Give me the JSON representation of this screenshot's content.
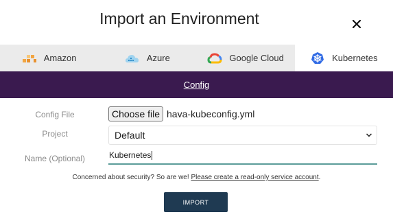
{
  "dialog": {
    "title": "Import an Environment",
    "close_icon": "close-icon"
  },
  "tabs": [
    {
      "label": "Amazon",
      "icon": "aws-icon",
      "active": false
    },
    {
      "label": "Azure",
      "icon": "azure-icon",
      "active": false
    },
    {
      "label": "Google Cloud",
      "icon": "google-cloud-icon",
      "active": false
    },
    {
      "label": "Kubernetes",
      "icon": "kubernetes-icon",
      "active": true
    }
  ],
  "config_tab": {
    "label": "Config"
  },
  "form": {
    "config_file": {
      "label": "Config File",
      "button": "Choose file",
      "file_name": "hava-kubeconfig.yml"
    },
    "project": {
      "label": "Project",
      "value": "Default"
    },
    "name": {
      "label": "Name (Optional)",
      "value": "Kubernetes"
    }
  },
  "security": {
    "text": "Concerned about security? So are we! ",
    "link": "Please create a read-only service account",
    "suffix": "."
  },
  "import_button": "IMPORT",
  "colors": {
    "config_bar": "#3a1a4f",
    "import_button": "#1f3a52",
    "input_underline": "#5b9c99",
    "tab_bar": "#ebebeb"
  }
}
